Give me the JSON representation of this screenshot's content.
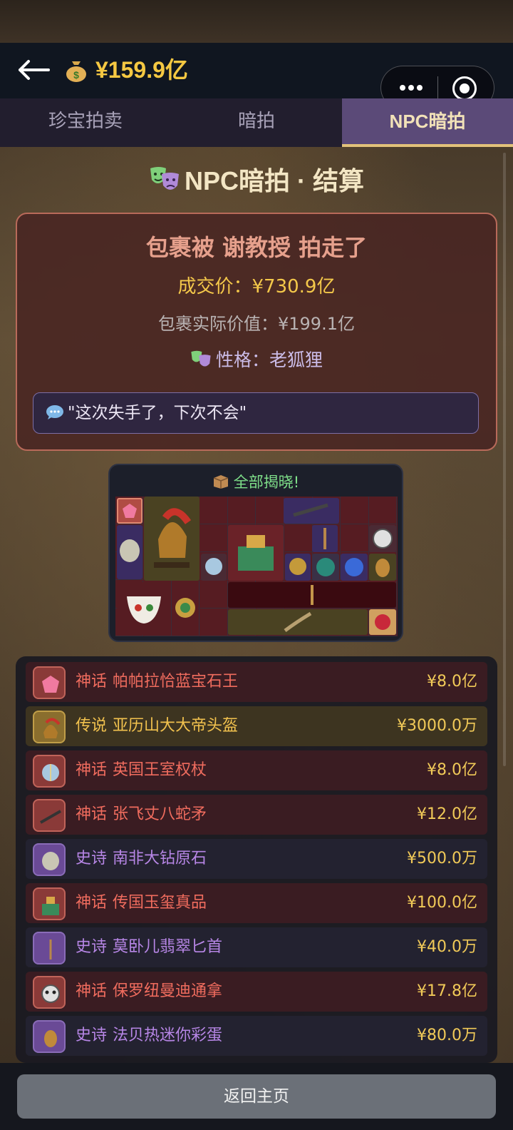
{
  "header": {
    "back_icon": "arrow-left-icon",
    "coin_icon": "money-bag-icon",
    "balance": "¥159.9亿",
    "menu_icon": "more-dots-icon",
    "close_icon": "target-circle-icon"
  },
  "tabs": [
    {
      "label": "珍宝拍卖",
      "active": false
    },
    {
      "label": "暗拍",
      "active": false
    },
    {
      "label": "NPC暗拍",
      "active": true
    }
  ],
  "section": {
    "title": "NPC暗拍 · 结算",
    "icon": "theater-masks-icon"
  },
  "result": {
    "title": "包裹被 谢教授 拍走了",
    "deal_price": "成交价：¥730.9亿",
    "actual_value": "包裹实际价值：¥199.1亿",
    "personality": "性格：老狐狸",
    "quote": "\"这次失手了，下次不会\""
  },
  "reveal": {
    "title": "全部揭晓!",
    "icon": "package-icon"
  },
  "items": [
    {
      "rarity": "神话",
      "name": "帕帕拉恰蓝宝石王",
      "price": "¥8.0亿",
      "tier": "myth",
      "icon": "gem-icon"
    },
    {
      "rarity": "传说",
      "name": "亚历山大大帝头盔",
      "price": "¥3000.0万",
      "tier": "legend",
      "icon": "helmet-icon"
    },
    {
      "rarity": "神话",
      "name": "英国王室权杖",
      "price": "¥8.0亿",
      "tier": "myth",
      "icon": "scepter-icon"
    },
    {
      "rarity": "神话",
      "name": "张飞丈八蛇矛",
      "price": "¥12.0亿",
      "tier": "myth",
      "icon": "spear-icon"
    },
    {
      "rarity": "史诗",
      "name": "南非大钻原石",
      "price": "¥500.0万",
      "tier": "epic",
      "icon": "rough-diamond-icon"
    },
    {
      "rarity": "神话",
      "name": "传国玉玺真品",
      "price": "¥100.0亿",
      "tier": "myth",
      "icon": "jade-seal-icon"
    },
    {
      "rarity": "史诗",
      "name": "莫卧儿翡翠匕首",
      "price": "¥40.0万",
      "tier": "epic",
      "icon": "dagger-icon"
    },
    {
      "rarity": "神话",
      "name": "保罗纽曼迪通拿",
      "price": "¥17.8亿",
      "tier": "myth",
      "icon": "watch-icon"
    },
    {
      "rarity": "史诗",
      "name": "法贝热迷你彩蛋",
      "price": "¥80.0万",
      "tier": "epic",
      "icon": "egg-icon"
    }
  ],
  "footer": {
    "home_button": "返回主页"
  }
}
